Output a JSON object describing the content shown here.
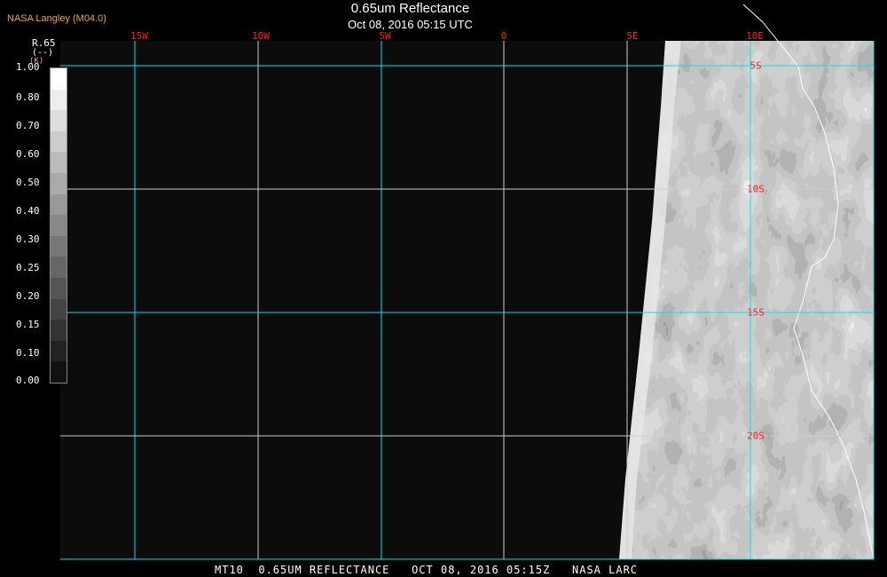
{
  "brand": "NASA Langley (M04.0)",
  "title": "0.65um Reflectance",
  "subtitle": "Oct 08, 2016 05:15 UTC",
  "colorbar": {
    "name": "R.65",
    "units": "(--)",
    "unit_k": "(K)",
    "labels": [
      "1.00",
      "0.80",
      "0.70",
      "0.60",
      "0.50",
      "0.40",
      "0.30",
      "0.25",
      "0.20",
      "0.15",
      "0.10",
      "0.00"
    ],
    "colors": [
      "#ffffff",
      "#eeeeee",
      "#dddddd",
      "#cccccc",
      "#bbbbbb",
      "#aaaaaa",
      "#999999",
      "#888888",
      "#777777",
      "#666666",
      "#555555",
      "#444444",
      "#333333",
      "#222222",
      "#111111"
    ]
  },
  "longitudes": [
    "15W",
    "10W",
    "5W",
    "0",
    "5E",
    "10E"
  ],
  "latitudes": [
    "5S",
    "10S",
    "15S",
    "20S"
  ],
  "footer": "MT10  0.65UM REFLECTANCE   OCT 08, 2016 05:15Z   NASA LARC",
  "colors": {
    "grid_cyan": "#00e5ee",
    "label_red": "#ff2020",
    "brand": "#f5a623"
  }
}
